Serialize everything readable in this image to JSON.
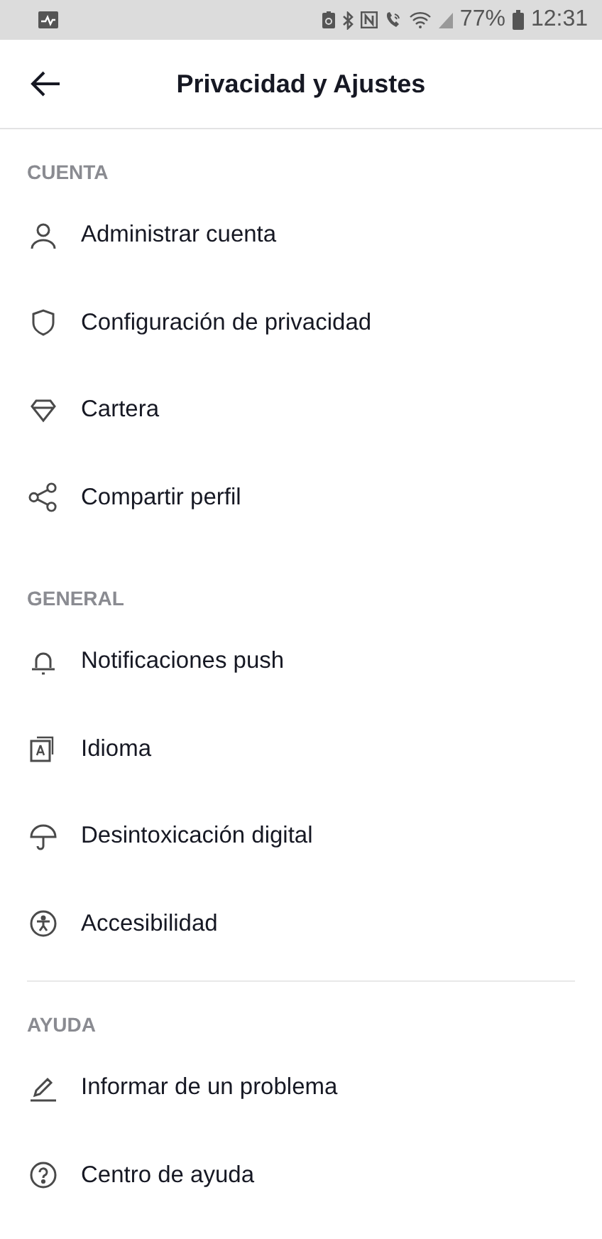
{
  "status_bar": {
    "battery_percent": "77%",
    "time": "12:31"
  },
  "header": {
    "title": "Privacidad y Ajustes"
  },
  "sections": [
    {
      "title": "CUENTA",
      "divider": false,
      "items": [
        {
          "label": "Administrar cuenta",
          "kind": "person"
        },
        {
          "label": "Configuración de privacidad",
          "kind": "shield"
        },
        {
          "label": "Cartera",
          "kind": "diamond"
        },
        {
          "label": "Compartir perfil",
          "kind": "share"
        }
      ]
    },
    {
      "title": "GENERAL",
      "divider": false,
      "items": [
        {
          "label": "Notificaciones push",
          "kind": "bell"
        },
        {
          "label": "Idioma",
          "kind": "language"
        },
        {
          "label": "Desintoxicación digital",
          "kind": "umbrella"
        },
        {
          "label": "Accesibilidad",
          "kind": "accessibility"
        }
      ]
    },
    {
      "title": "AYUDA",
      "divider": true,
      "items": [
        {
          "label": "Informar de un problema",
          "kind": "pencil"
        },
        {
          "label": "Centro de ayuda",
          "kind": "help"
        }
      ]
    }
  ]
}
